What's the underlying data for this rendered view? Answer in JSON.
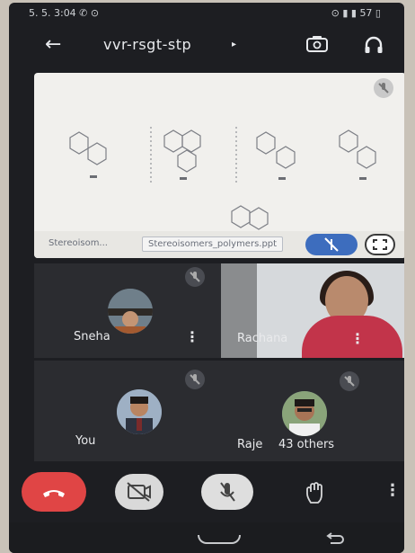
{
  "status_bar": {
    "left": "5. 5. 3:04 ✆ ⊙",
    "right": "⊙ ▮ ▮ 57 ▯"
  },
  "header": {
    "meeting_code": "vvr-rsgt-stp",
    "caret": "▸"
  },
  "presentation": {
    "footer_left": "Stereoisom...",
    "footer_middle": "Stereoisomers_polymers.ppt"
  },
  "participants": [
    {
      "name": "Sneha",
      "more": "⋮"
    },
    {
      "name": "Rachana",
      "more": "⋮"
    },
    {
      "name": "You"
    },
    {
      "name": "Raje",
      "others": "43 others"
    }
  ],
  "controls": {
    "overflow": "⋮"
  },
  "colors": {
    "end_call": "#e04545",
    "pin_active": "#3d6dbe",
    "tile_bg": "#2b2c30"
  }
}
